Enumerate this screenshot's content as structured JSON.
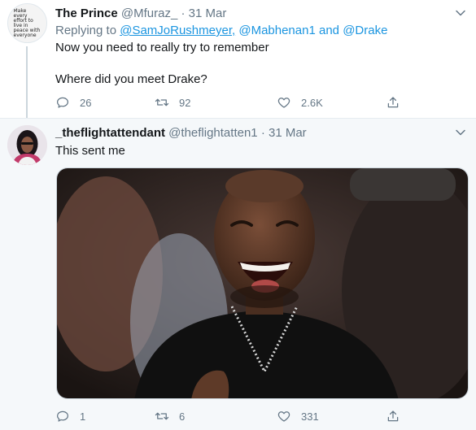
{
  "tweet1": {
    "avatar_text": "Make every effort to live in peace with everyone",
    "name": "The Prince",
    "handle": "@Mfuraz_",
    "separator": "·",
    "date": "31 Mar",
    "replying_prefix": "Replying to",
    "replying_user1": "@SamJoRushmeyer,",
    "replying_user2": "@Mabhenan1",
    "replying_and": "and",
    "replying_user3": "@Drake",
    "text_line1": "Now you need to really try to remember",
    "text_line2": "Where did you meet Drake?",
    "reply_count": "26",
    "retweet_count": "92",
    "like_count": "2.6K"
  },
  "tweet2": {
    "name": "_theflightattendant",
    "handle": "@theflightatten1",
    "separator": "·",
    "date": "31 Mar",
    "text": "This sent me",
    "reply_count": "1",
    "retweet_count": "6",
    "like_count": "331"
  },
  "colors": {
    "link": "#1b95e0",
    "muted": "#657786",
    "text": "#14171a",
    "highlight_bg": "#f5f8fa"
  },
  "icons": [
    "reply-icon",
    "retweet-icon",
    "like-icon",
    "share-icon",
    "chevron-down-icon"
  ]
}
